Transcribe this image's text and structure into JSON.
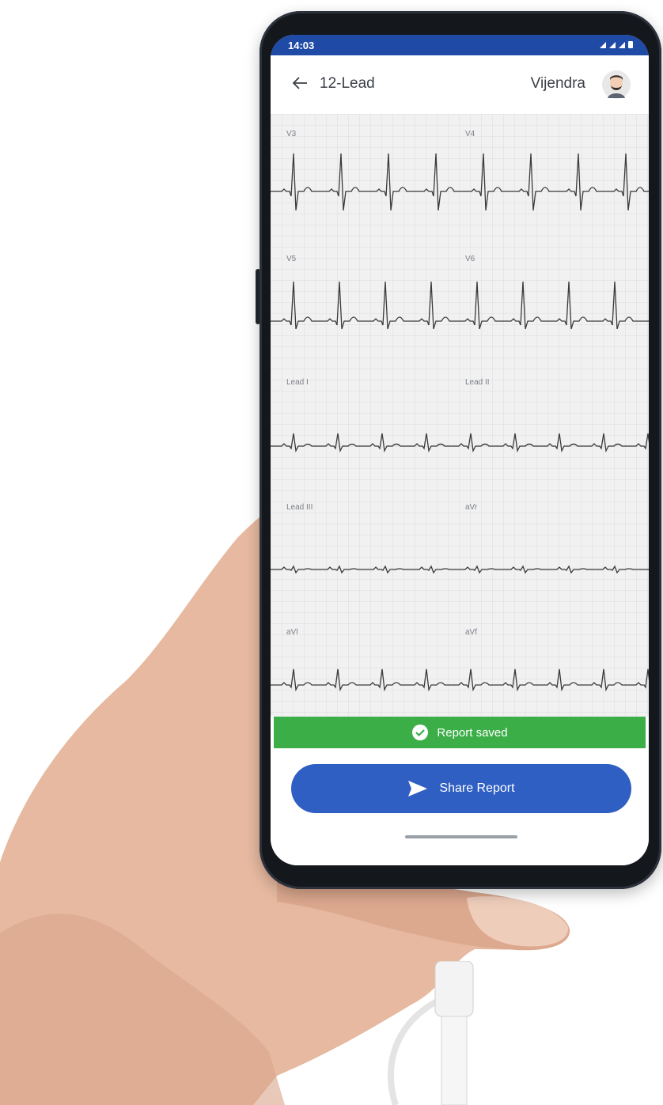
{
  "status_bar": {
    "time": "14:03",
    "icons": "◀ ■ ▮"
  },
  "app_bar": {
    "title": "12-Lead",
    "user_name": "Vijendra"
  },
  "leads": [
    {
      "label": "V3"
    },
    {
      "label": "V4"
    },
    {
      "label": "V5"
    },
    {
      "label": "V6"
    },
    {
      "label": "Lead I"
    },
    {
      "label": "Lead II"
    },
    {
      "label": "Lead III"
    },
    {
      "label": "aVr"
    },
    {
      "label": "aVl"
    },
    {
      "label": "aVf"
    }
  ],
  "banner": {
    "text": "Report saved"
  },
  "share_button": {
    "label": "Share Report"
  },
  "colors": {
    "status_bar": "#1f4aa6",
    "banner": "#3cae48",
    "share_button": "#2f5fc2",
    "ecg_trace": "#3a3a3a"
  }
}
